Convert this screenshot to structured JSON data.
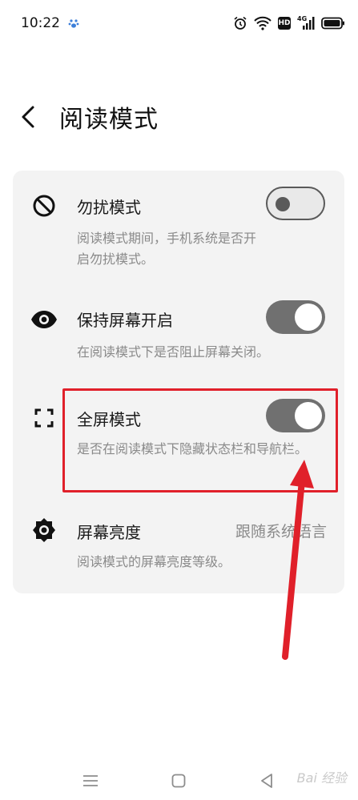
{
  "status_bar": {
    "time": "10:22",
    "network_label": "4G",
    "hd_label": "HD",
    "icons": [
      "notification-paw-icon",
      "alarm-icon",
      "wifi-icon",
      "hd-icon",
      "signal-icon",
      "battery-icon"
    ]
  },
  "header": {
    "title": "阅读模式",
    "back_icon": "chevron-left-icon"
  },
  "settings": [
    {
      "id": "dnd",
      "icon": "do-not-disturb-icon",
      "title": "勿扰模式",
      "description": "阅读模式期间，手机系统是否开启勿扰模式。",
      "control": "toggle",
      "state": "off"
    },
    {
      "id": "keep-screen-on",
      "icon": "eye-icon",
      "title": "保持屏幕开启",
      "description": "在阅读模式下是否阻止屏幕关闭。",
      "control": "toggle",
      "state": "on"
    },
    {
      "id": "fullscreen",
      "icon": "fullscreen-icon",
      "title": "全屏模式",
      "description": "是否在阅读模式下隐藏状态栏和导航栏。",
      "control": "toggle",
      "state": "on"
    },
    {
      "id": "brightness",
      "icon": "brightness-gear-icon",
      "title": "屏幕亮度",
      "description": "阅读模式的屏幕亮度等级。",
      "control": "value",
      "value": "跟随系统语言"
    }
  ],
  "annotation": {
    "color": "#e0202a",
    "target": "fullscreen"
  },
  "nav_bar": {
    "icons": [
      "menu-icon",
      "home-icon",
      "back-triangle-icon"
    ]
  },
  "watermark": "Bai 经验"
}
